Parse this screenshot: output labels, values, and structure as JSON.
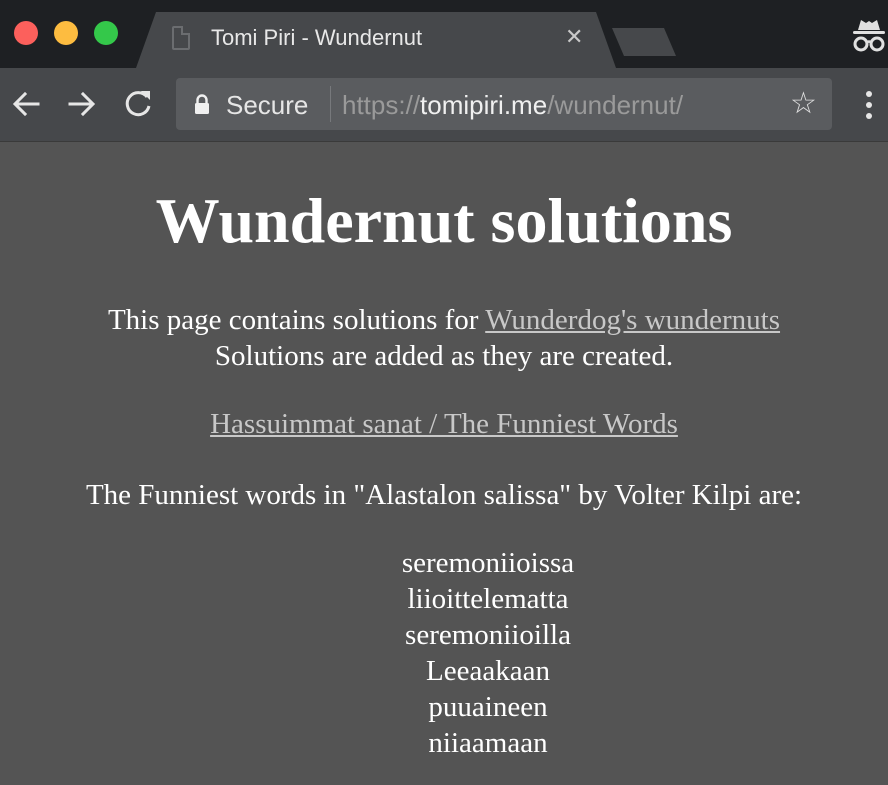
{
  "browser": {
    "tab": {
      "title": "Tomi Piri - Wundernut",
      "close_glyph": "✕"
    },
    "toolbar": {
      "secure_label": "Secure",
      "url_scheme": "https://",
      "url_host": "tomipiri.me",
      "url_path": "/wundernut/",
      "star_glyph": "☆"
    },
    "icons": [
      "back-icon",
      "forward-icon",
      "reload-icon",
      "lock-icon",
      "bookmark-star-icon",
      "menu-icon",
      "incognito-icon",
      "page-icon",
      "close-icon"
    ]
  },
  "page": {
    "title": "Wundernut solutions",
    "intro_text": "This page contains solutions for ",
    "intro_link": "Wunderdog's wundernuts",
    "intro_text2": "Solutions are added as they are created.",
    "section_link": "Hassuimmat sanat / The Funniest Words",
    "result_text": "The Funniest words in \"Alastalon salissa\" by Volter Kilpi are:",
    "words": [
      "seremoniioissa",
      "liioittelematta",
      "seremoniioilla",
      "Leeaakaan",
      "puuaineen",
      "niiaamaan"
    ]
  },
  "colors": {
    "page_background": "#545454",
    "toolbar_background": "#46484b",
    "titlebar_background": "#1e2023",
    "link": "#c8c8c8",
    "text": "#ffffff"
  }
}
